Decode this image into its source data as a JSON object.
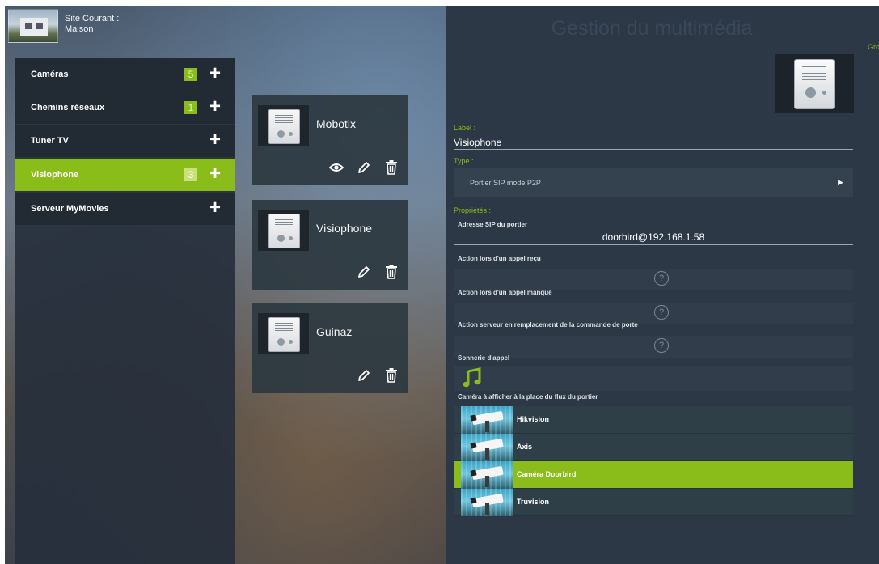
{
  "site": {
    "label_line1": "Site Courant :",
    "label_line2": "Maison"
  },
  "menu": {
    "items": [
      {
        "label": "Caméras",
        "count": "5",
        "plus": "+"
      },
      {
        "label": "Chemins réseaux",
        "count": "1",
        "plus": "+"
      },
      {
        "label": "Tuner TV",
        "count": "",
        "plus": "+"
      },
      {
        "label": "Visiophone",
        "count": "3",
        "plus": "+"
      },
      {
        "label": "Serveur MyMovies",
        "count": "",
        "plus": "+"
      }
    ],
    "active_index": 3
  },
  "devices": [
    {
      "name": "Mobotix"
    },
    {
      "name": "Visiophone"
    },
    {
      "name": "Guinaz"
    }
  ],
  "detail": {
    "title": "Gestion du multimédia",
    "edge_text": "Gro",
    "label_heading": "Label :",
    "label_value": "Visiophone",
    "type_heading": "Type :",
    "type_value": "Portier SIP mode P2P",
    "type_arrow": "▶",
    "props_heading": "Propriétés :",
    "sip_label": "Adresse SIP du portier",
    "sip_value": "doorbird@192.168.1.58",
    "action_received_label": "Action lors d'un appel reçu",
    "action_missed_label": "Action lors d'un appel manqué",
    "action_server_label": "Action serveur en remplacement de la commande de porte",
    "ringtone_label": "Sonnerie d'appel",
    "camera_label": "Caméra à afficher à la place du flux du portier",
    "help_glyph": "?",
    "cameras": [
      {
        "name": "Hikvision"
      },
      {
        "name": "Axis"
      },
      {
        "name": "Caméra Doorbird"
      },
      {
        "name": "Truvision"
      }
    ],
    "selected_camera_index": 2
  },
  "colors": {
    "accent": "#8bbd1a",
    "panel": "#2c3845",
    "menu_bg": "#222a33"
  },
  "icons": {
    "view": "eye-icon",
    "edit": "pencil-icon",
    "delete": "trash-icon",
    "ringtone": "music-note-icon",
    "help": "help-circle-icon"
  }
}
